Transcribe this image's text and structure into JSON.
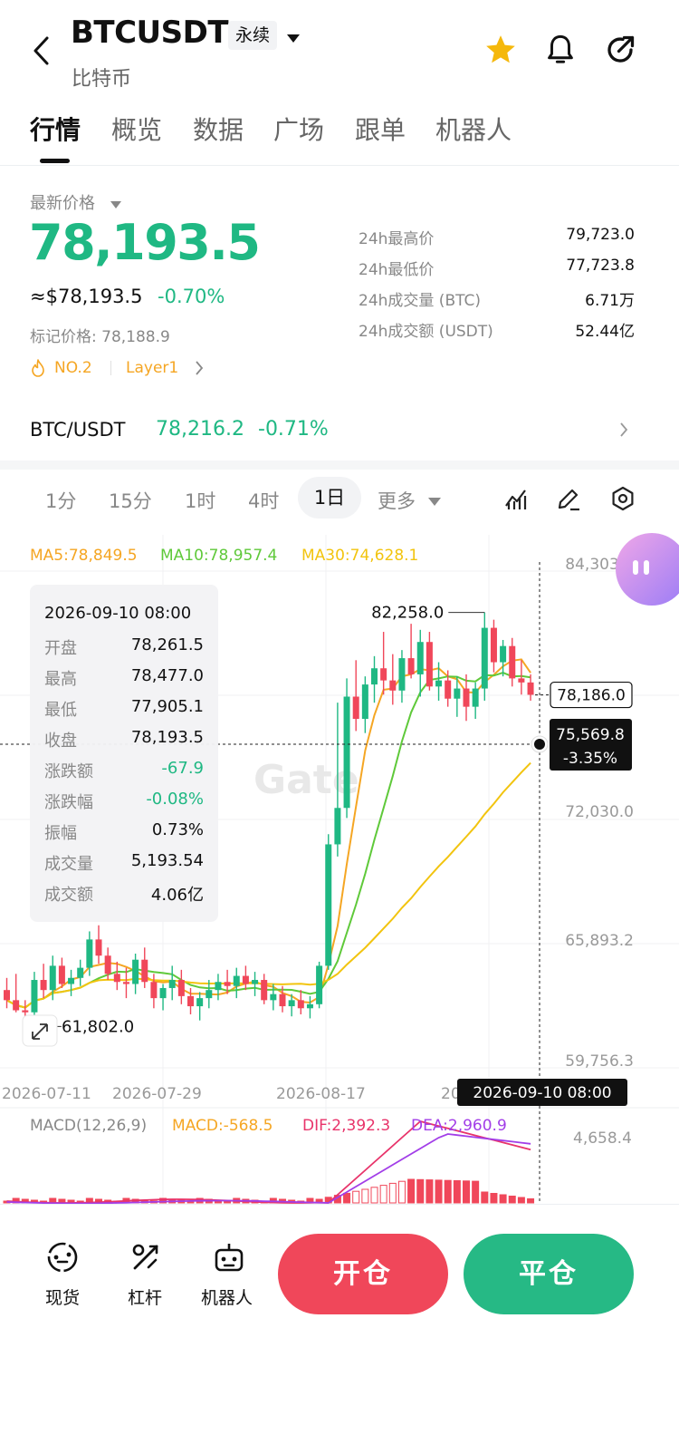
{
  "header": {
    "symbol": "BTCUSDT",
    "type_badge": "永续",
    "subtitle": "比特币"
  },
  "nav_tabs": [
    "行情",
    "概览",
    "数据",
    "广场",
    "跟单",
    "机器人"
  ],
  "price": {
    "label": "最新价格",
    "last": "78,193.5",
    "usd": "≈$78,193.5",
    "change": "-0.70%",
    "mark_label": "标记价格: 78,188.9",
    "rank": "NO.2",
    "sector": "Layer1"
  },
  "stats": [
    {
      "label": "24h最高价",
      "value": "79,723.0"
    },
    {
      "label": "24h最低价",
      "value": "77,723.8"
    },
    {
      "label": "24h成交量 (BTC)",
      "value": "6.71万"
    },
    {
      "label": "24h成交额 (USDT)",
      "value": "52.44亿"
    }
  ],
  "spot_pair": {
    "pair": "BTC/USDT",
    "price": "78,216.2",
    "change": "-0.71%"
  },
  "intervals": [
    "1分",
    "15分",
    "1时",
    "4时",
    "1日",
    "更多"
  ],
  "active_interval": "1日",
  "ma_legend": {
    "ma5": "MA5:78,849.5",
    "ma10": "MA10:78,957.4",
    "ma30": "MA30:74,628.1"
  },
  "tooltip": {
    "date": "2026-09-10 08:00",
    "rows": [
      {
        "label": "开盘",
        "value": "78,261.5"
      },
      {
        "label": "最高",
        "value": "78,477.0"
      },
      {
        "label": "最低",
        "value": "77,905.1"
      },
      {
        "label": "收盘",
        "value": "78,193.5"
      },
      {
        "label": "涨跌额",
        "value": "-67.9"
      },
      {
        "label": "涨跌幅",
        "value": "-0.08%"
      },
      {
        "label": "振幅",
        "value": "0.73%"
      },
      {
        "label": "成交量",
        "value": "5,193.54"
      },
      {
        "label": "成交额",
        "value": "4.06亿"
      }
    ]
  },
  "chart_labels": {
    "high": "82,258.0",
    "low": "61,802.0",
    "current_price": "78,186.0",
    "cross_price": "75,569.8",
    "cross_pct": "-3.35%",
    "cross_date": "2026-09-10 08:00",
    "watermark": "Gate"
  },
  "chart_data": {
    "type": "candlestick",
    "y_ticks": [
      "84,303.5",
      "72,030.0",
      "65,893.2",
      "59,756.3"
    ],
    "x_ticks": [
      "2026-07-11",
      "2026-07-29",
      "2026-08-17",
      "20"
    ],
    "ohlc": [
      [
        63.6,
        64.2,
        62.7,
        63.1
      ],
      [
        63.1,
        64.4,
        62.5,
        62.6
      ],
      [
        62.6,
        63.1,
        61.8,
        62.5
      ],
      [
        62.5,
        64.5,
        62.0,
        64.1
      ],
      [
        64.1,
        64.9,
        63.2,
        63.6
      ],
      [
        63.6,
        65.3,
        63.1,
        64.8
      ],
      [
        64.8,
        65.2,
        63.7,
        63.9
      ],
      [
        63.9,
        64.6,
        63.3,
        64.2
      ],
      [
        64.2,
        65.1,
        63.8,
        64.7
      ],
      [
        64.7,
        66.5,
        64.3,
        66.1
      ],
      [
        66.1,
        66.8,
        64.9,
        65.3
      ],
      [
        65.3,
        65.7,
        64.1,
        64.4
      ],
      [
        64.4,
        65.0,
        63.6,
        64.0
      ],
      [
        64.0,
        64.7,
        63.2,
        63.9
      ],
      [
        63.9,
        65.4,
        63.4,
        65.1
      ],
      [
        65.1,
        65.7,
        63.7,
        64.0
      ],
      [
        64.0,
        64.4,
        62.7,
        63.2
      ],
      [
        63.2,
        63.9,
        62.6,
        63.7
      ],
      [
        63.7,
        64.8,
        63.1,
        64.1
      ],
      [
        64.1,
        64.6,
        62.9,
        63.3
      ],
      [
        63.3,
        63.7,
        62.4,
        62.8
      ],
      [
        62.8,
        63.5,
        62.1,
        63.2
      ],
      [
        63.2,
        64.1,
        62.7,
        63.6
      ],
      [
        63.6,
        64.4,
        63.1,
        64.0
      ],
      [
        64.0,
        64.6,
        63.4,
        63.8
      ],
      [
        63.8,
        64.7,
        63.2,
        64.3
      ],
      [
        64.3,
        64.8,
        63.6,
        63.9
      ],
      [
        63.9,
        64.5,
        63.3,
        64.1
      ],
      [
        64.1,
        64.4,
        62.9,
        63.1
      ],
      [
        63.1,
        63.9,
        62.6,
        63.4
      ],
      [
        63.4,
        63.8,
        62.5,
        62.8
      ],
      [
        62.8,
        63.4,
        62.3,
        63.1
      ],
      [
        63.1,
        63.6,
        62.4,
        62.7
      ],
      [
        62.7,
        63.3,
        62.2,
        62.9
      ],
      [
        62.9,
        65.0,
        62.7,
        64.8
      ],
      [
        64.8,
        71.3,
        64.6,
        70.8
      ],
      [
        70.8,
        77.8,
        70.2,
        72.6
      ],
      [
        72.6,
        79.0,
        72.1,
        78.1
      ],
      [
        78.1,
        79.9,
        76.4,
        77.0
      ],
      [
        77.0,
        79.1,
        76.3,
        78.7
      ],
      [
        78.7,
        80.1,
        77.8,
        79.5
      ],
      [
        79.5,
        81.3,
        78.2,
        78.9
      ],
      [
        78.9,
        80.2,
        77.7,
        78.4
      ],
      [
        78.4,
        80.4,
        77.8,
        80.0
      ],
      [
        80.0,
        81.7,
        79.0,
        79.2
      ],
      [
        79.2,
        81.4,
        78.1,
        80.8
      ],
      [
        80.8,
        81.3,
        78.4,
        78.6
      ],
      [
        78.6,
        79.8,
        77.9,
        78.9
      ],
      [
        78.9,
        79.4,
        77.6,
        78.0
      ],
      [
        78.0,
        79.1,
        77.1,
        78.5
      ],
      [
        78.5,
        79.2,
        76.9,
        77.6
      ],
      [
        77.6,
        78.8,
        77.0,
        78.5
      ],
      [
        78.5,
        82.26,
        77.9,
        81.5
      ],
      [
        81.5,
        81.9,
        79.3,
        79.8
      ],
      [
        79.8,
        80.9,
        79.1,
        80.6
      ],
      [
        80.6,
        81.0,
        78.6,
        79.0
      ],
      [
        79.0,
        79.9,
        78.2,
        78.8
      ],
      [
        78.8,
        79.2,
        77.9,
        78.19
      ]
    ],
    "ma5": "MA5:78,849.5",
    "ma10": "MA10:78,957.4",
    "ma30": "MA30:74,628.1",
    "macd": {
      "label": "MACD(12,26,9)",
      "macd": "MACD:-568.5",
      "dif": "DIF:2,392.3",
      "dea": "DEA:2,960.9",
      "y_tick": "4,658.4"
    }
  },
  "bottom_bar": {
    "items": [
      {
        "label": "现货"
      },
      {
        "label": "杠杆"
      },
      {
        "label": "机器人"
      }
    ],
    "open": "开仓",
    "close": "平仓"
  },
  "colors": {
    "green": "#1fb883",
    "red": "#f0475a",
    "ma5": "#f5a623",
    "ma10": "#5fc93a",
    "ma30": "#f2c40f"
  }
}
